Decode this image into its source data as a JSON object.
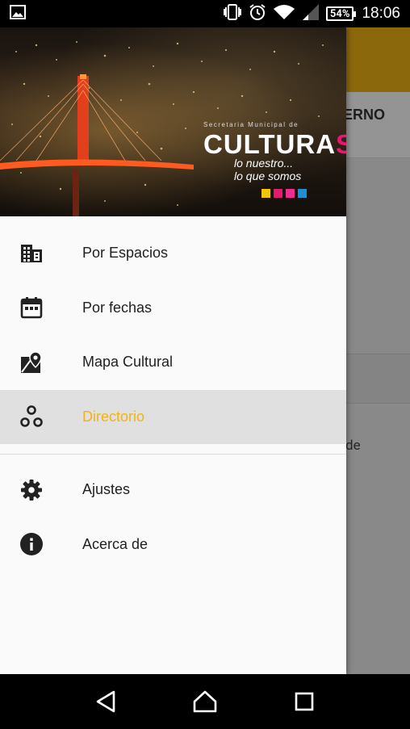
{
  "status_bar": {
    "time": "18:06",
    "battery_percent": "54%",
    "icons": [
      "image-icon",
      "vibrate-icon",
      "alarm-icon",
      "wifi-icon",
      "signal-icon"
    ]
  },
  "background_app": {
    "tab_text": "ERNO",
    "description_fragment": "de",
    "toolbar_color": "#f1b418"
  },
  "drawer": {
    "header": {
      "logo_small": "Secretaria Municipal de",
      "logo_big": "CULTURA",
      "logo_big_s": "S",
      "logo_tag_line1": "lo nuestro...",
      "logo_tag_line2": "lo que somos",
      "logo_square_colors": [
        "#f5c400",
        "#e8176f",
        "#ee2e8e",
        "#1d8fd6"
      ]
    },
    "items": [
      {
        "label": "Por Espacios",
        "icon": "building-icon",
        "active": false
      },
      {
        "label": "Por fechas",
        "icon": "calendar-icon",
        "active": false
      },
      {
        "label": "Mapa Cultural",
        "icon": "map-marker-icon",
        "active": false
      },
      {
        "label": "Directorio",
        "icon": "group-nodes-icon",
        "active": true
      }
    ],
    "secondary_items": [
      {
        "label": "Ajustes",
        "icon": "gear-icon"
      },
      {
        "label": "Acerca de",
        "icon": "info-icon"
      }
    ],
    "accent_color": "#f1b418"
  },
  "nav_bar": {
    "buttons": [
      "back-icon",
      "home-icon",
      "recents-icon"
    ]
  }
}
